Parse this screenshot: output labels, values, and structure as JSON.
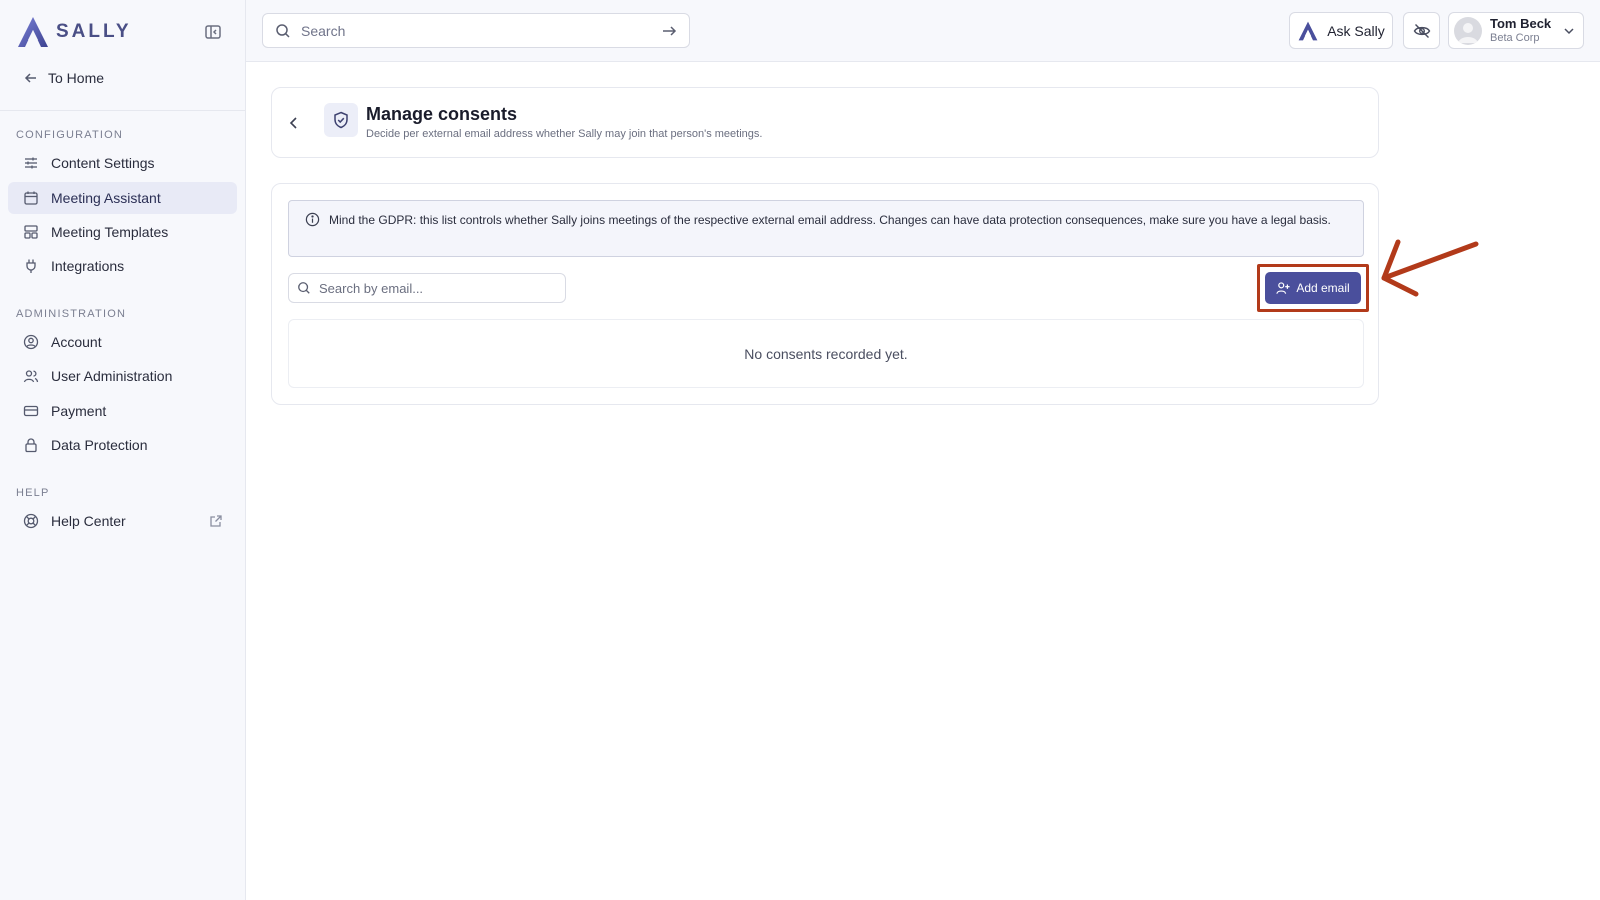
{
  "brand": {
    "name": "SALLY"
  },
  "sidebar": {
    "to_home": "To Home",
    "sections": [
      {
        "label": "CONFIGURATION"
      },
      {
        "label": "ADMINISTRATION"
      },
      {
        "label": "HELP"
      }
    ],
    "items": [
      {
        "label": "Content Settings",
        "icon": "sliders-icon"
      },
      {
        "label": "Meeting Assistant",
        "icon": "calendar-icon",
        "active": true
      },
      {
        "label": "Meeting Templates",
        "icon": "template-icon"
      },
      {
        "label": "Integrations",
        "icon": "plug-icon"
      },
      {
        "label": "Account",
        "icon": "user-circle-icon"
      },
      {
        "label": "User Administration",
        "icon": "users-icon"
      },
      {
        "label": "Payment",
        "icon": "credit-card-icon"
      },
      {
        "label": "Data Protection",
        "icon": "lock-icon"
      },
      {
        "label": "Help Center",
        "icon": "lifebuoy-icon",
        "external": true
      }
    ]
  },
  "header": {
    "search_placeholder": "Search",
    "ask_label": "Ask Sally",
    "user": {
      "name": "Tom Beck",
      "org": "Beta Corp"
    }
  },
  "page": {
    "title": "Manage consents",
    "subtitle": "Decide per external email address whether Sally may join that person's meetings.",
    "gdpr_notice": "Mind the GDPR: this list controls whether Sally joins meetings of the respective external email address. Changes can have data protection consequences, make sure you have a legal basis.",
    "email_search_placeholder": "Search by email...",
    "add_email_label": "Add email",
    "empty_state": "No consents recorded yet."
  },
  "colors": {
    "accent": "#4a4f9c",
    "annotation": "#b23a1a",
    "active_nav_bg": "#e8eaf6"
  }
}
